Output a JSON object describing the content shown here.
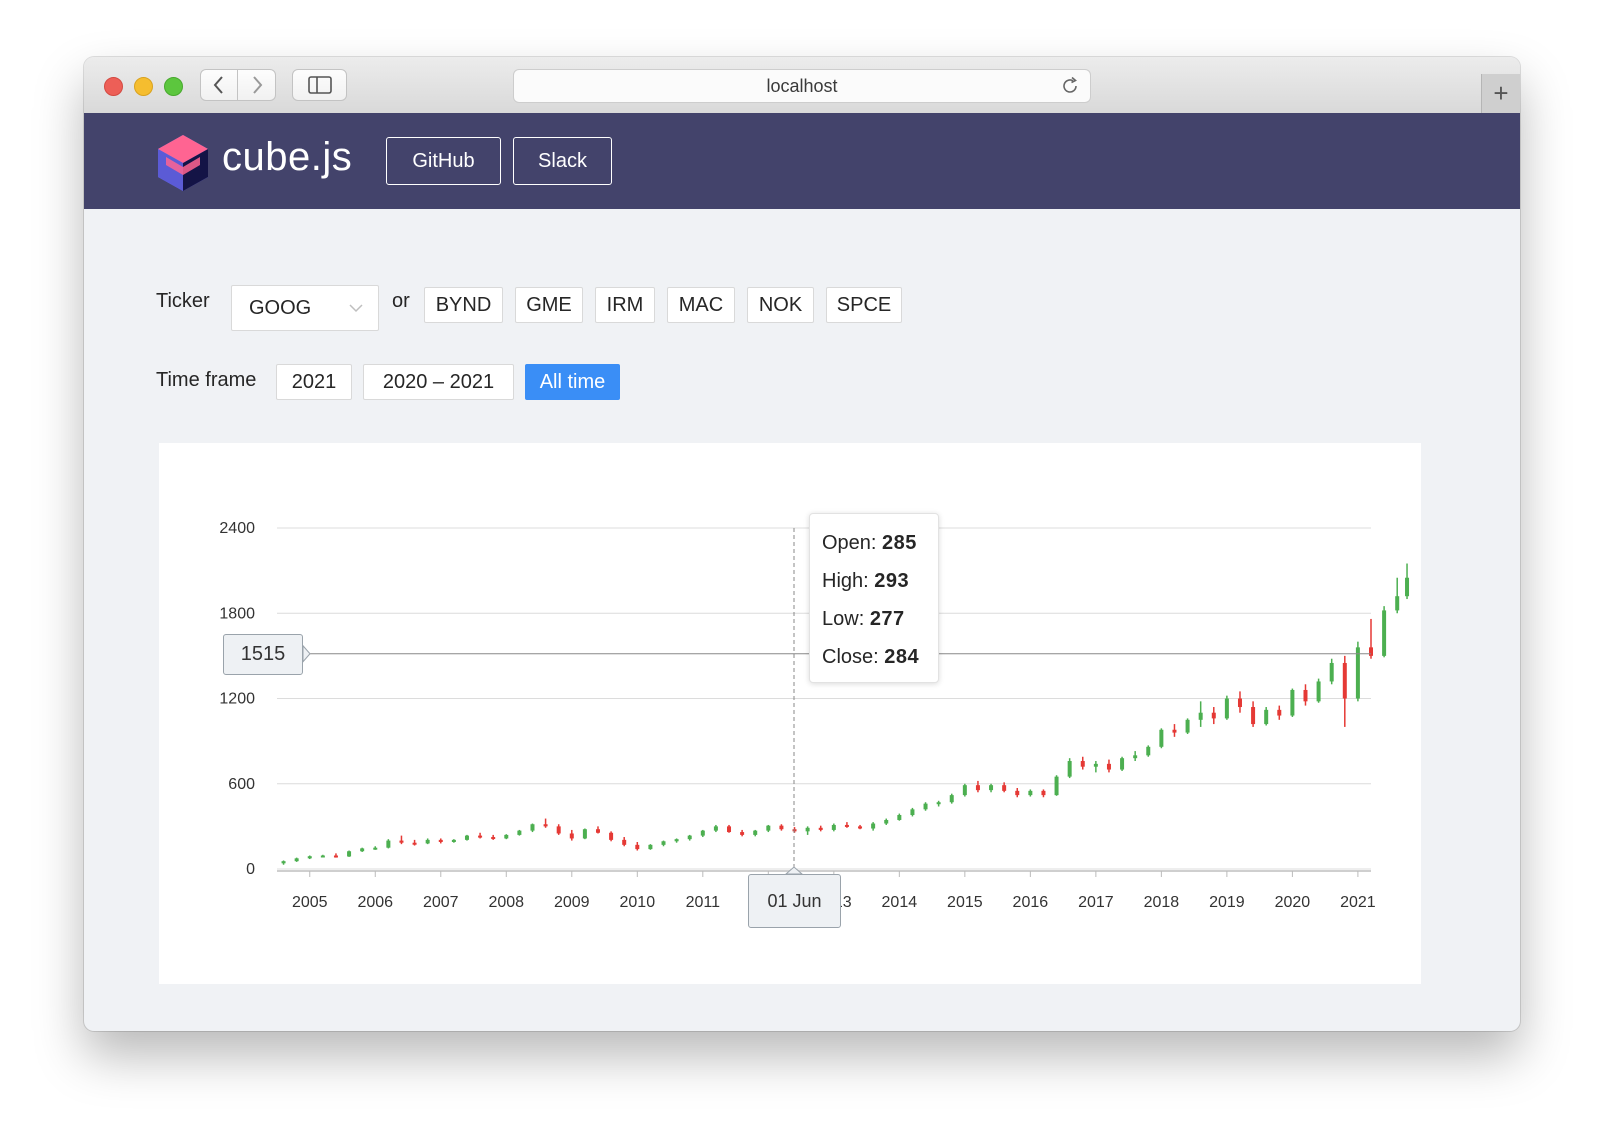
{
  "browser": {
    "url": "localhost",
    "new_tab_label": "+"
  },
  "header": {
    "brand": "cube.js",
    "buttons": [
      "GitHub",
      "Slack"
    ],
    "colors": {
      "background": "#43436b"
    }
  },
  "controls": {
    "ticker_label": "Ticker",
    "ticker_selected": "GOOG",
    "or_label": "or",
    "ticker_options": [
      "BYND",
      "GME",
      "IRM",
      "MAC",
      "NOK",
      "SPCE"
    ],
    "timeframe_label": "Time frame",
    "timeframe_options": [
      "2021",
      "2020 – 2021",
      "All time"
    ],
    "timeframe_active": "All time",
    "active_color": "#3a8ef6"
  },
  "crosshair": {
    "y_value": "1515",
    "x_value": "01 Jun"
  },
  "tooltip": {
    "open_label": "Open:",
    "open_value": "285",
    "high_label": "High:",
    "high_value": "293",
    "low_label": "Low:",
    "low_value": "277",
    "close_label": "Close:",
    "close_value": "284"
  },
  "chart_data": {
    "type": "candlestick",
    "ylim": [
      0,
      2400
    ],
    "yticks": [
      0,
      600,
      1200,
      1800,
      2400
    ],
    "xlim": [
      2004.5,
      2021.2
    ],
    "xticks": [
      "2005",
      "2006",
      "2007",
      "2008",
      "2009",
      "2010",
      "2011",
      "2012",
      "2013",
      "2014",
      "2015",
      "2016",
      "2017",
      "2018",
      "2019",
      "2020",
      "2021"
    ],
    "up_color": "#4caf50",
    "down_color": "#e53935",
    "grid": true,
    "series": [
      [
        2004.6,
        40,
        60,
        30,
        55
      ],
      [
        2004.8,
        55,
        80,
        50,
        75
      ],
      [
        2005.0,
        75,
        95,
        70,
        90
      ],
      [
        2005.2,
        90,
        100,
        85,
        95
      ],
      [
        2005.4,
        95,
        110,
        80,
        88
      ],
      [
        2005.6,
        88,
        130,
        85,
        125
      ],
      [
        2005.8,
        125,
        150,
        120,
        145
      ],
      [
        2006.0,
        145,
        160,
        135,
        150
      ],
      [
        2006.2,
        150,
        210,
        145,
        200
      ],
      [
        2006.4,
        200,
        235,
        175,
        185
      ],
      [
        2006.6,
        185,
        205,
        165,
        180
      ],
      [
        2006.8,
        180,
        215,
        175,
        205
      ],
      [
        2007.0,
        205,
        215,
        180,
        190
      ],
      [
        2007.2,
        190,
        210,
        185,
        205
      ],
      [
        2007.4,
        205,
        240,
        200,
        235
      ],
      [
        2007.6,
        235,
        255,
        215,
        225
      ],
      [
        2007.8,
        225,
        240,
        205,
        215
      ],
      [
        2008.0,
        215,
        245,
        210,
        240
      ],
      [
        2008.2,
        240,
        275,
        235,
        270
      ],
      [
        2008.4,
        270,
        320,
        260,
        315
      ],
      [
        2008.6,
        315,
        355,
        290,
        300
      ],
      [
        2008.8,
        300,
        315,
        240,
        250
      ],
      [
        2009.0,
        250,
        275,
        200,
        215
      ],
      [
        2009.2,
        215,
        285,
        210,
        280
      ],
      [
        2009.4,
        280,
        300,
        250,
        255
      ],
      [
        2009.6,
        255,
        265,
        195,
        205
      ],
      [
        2009.8,
        205,
        225,
        160,
        170
      ],
      [
        2010.0,
        170,
        190,
        130,
        140
      ],
      [
        2010.2,
        140,
        175,
        135,
        170
      ],
      [
        2010.4,
        170,
        200,
        160,
        195
      ],
      [
        2010.6,
        195,
        215,
        185,
        210
      ],
      [
        2010.8,
        210,
        240,
        200,
        235
      ],
      [
        2011.0,
        235,
        275,
        225,
        270
      ],
      [
        2011.2,
        270,
        310,
        260,
        300
      ],
      [
        2011.4,
        300,
        310,
        255,
        260
      ],
      [
        2011.6,
        260,
        275,
        230,
        240
      ],
      [
        2011.8,
        240,
        275,
        230,
        270
      ],
      [
        2012.0,
        270,
        310,
        260,
        305
      ],
      [
        2012.2,
        305,
        315,
        270,
        280
      ],
      [
        2012.4,
        280,
        295,
        255,
        265
      ],
      [
        2012.6,
        265,
        300,
        240,
        290
      ],
      [
        2012.8,
        290,
        305,
        265,
        275
      ],
      [
        2013.0,
        275,
        320,
        265,
        310
      ],
      [
        2013.2,
        310,
        330,
        290,
        300
      ],
      [
        2013.4,
        300,
        310,
        280,
        285
      ],
      [
        2013.6,
        285,
        330,
        270,
        320
      ],
      [
        2013.8,
        320,
        355,
        310,
        345
      ],
      [
        2014.0,
        345,
        390,
        340,
        380
      ],
      [
        2014.2,
        380,
        430,
        370,
        420
      ],
      [
        2014.4,
        420,
        470,
        410,
        460
      ],
      [
        2014.6,
        460,
        480,
        440,
        470
      ],
      [
        2014.8,
        470,
        530,
        460,
        520
      ],
      [
        2015.0,
        520,
        600,
        510,
        590
      ],
      [
        2015.2,
        590,
        620,
        540,
        555
      ],
      [
        2015.4,
        555,
        600,
        540,
        590
      ],
      [
        2015.6,
        590,
        610,
        540,
        550
      ],
      [
        2015.8,
        550,
        570,
        505,
        520
      ],
      [
        2016.0,
        520,
        560,
        510,
        550
      ],
      [
        2016.2,
        550,
        560,
        505,
        520
      ],
      [
        2016.4,
        520,
        660,
        515,
        650
      ],
      [
        2016.6,
        650,
        780,
        640,
        760
      ],
      [
        2016.8,
        760,
        790,
        700,
        720
      ],
      [
        2017.0,
        720,
        760,
        680,
        740
      ],
      [
        2017.2,
        740,
        770,
        680,
        700
      ],
      [
        2017.4,
        700,
        790,
        690,
        780
      ],
      [
        2017.6,
        780,
        830,
        760,
        800
      ],
      [
        2017.8,
        800,
        870,
        790,
        860
      ],
      [
        2018.0,
        860,
        990,
        850,
        980
      ],
      [
        2018.2,
        980,
        1020,
        930,
        960
      ],
      [
        2018.4,
        960,
        1060,
        950,
        1050
      ],
      [
        2018.6,
        1050,
        1180,
        1000,
        1100
      ],
      [
        2018.8,
        1100,
        1140,
        1020,
        1060
      ],
      [
        2019.0,
        1060,
        1220,
        1050,
        1200
      ],
      [
        2019.2,
        1200,
        1250,
        1100,
        1140
      ],
      [
        2019.4,
        1140,
        1180,
        1000,
        1020
      ],
      [
        2019.6,
        1020,
        1140,
        1010,
        1120
      ],
      [
        2019.8,
        1120,
        1150,
        1050,
        1080
      ],
      [
        2020.0,
        1080,
        1270,
        1070,
        1260
      ],
      [
        2020.2,
        1260,
        1300,
        1150,
        1180
      ],
      [
        2020.4,
        1180,
        1340,
        1170,
        1320
      ],
      [
        2020.6,
        1320,
        1480,
        1300,
        1450
      ],
      [
        2020.8,
        1450,
        1500,
        1000,
        1200
      ],
      [
        2021.0,
        1200,
        1600,
        1180,
        1560
      ],
      [
        2021.2,
        1560,
        1760,
        1480,
        1500
      ],
      [
        2021.4,
        1500,
        1850,
        1490,
        1820
      ],
      [
        2021.6,
        1820,
        2050,
        1800,
        1920
      ],
      [
        2021.75,
        1920,
        2150,
        1900,
        2050
      ]
    ]
  }
}
